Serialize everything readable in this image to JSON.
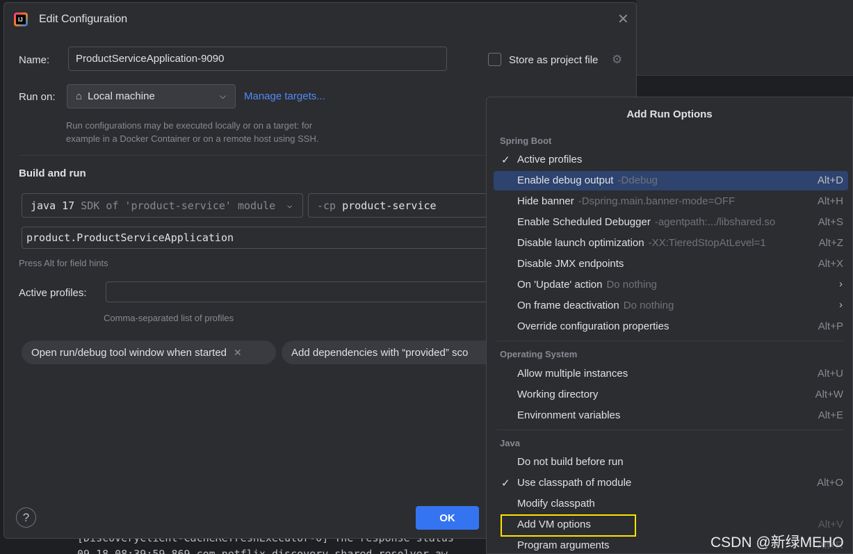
{
  "dialog": {
    "title": "Edit Configuration",
    "name_label": "Name:",
    "name_value": "ProductServiceApplication-9090",
    "store_label": "Store as project file",
    "run_on_label": "Run on:",
    "run_on_value": "Local machine",
    "manage_targets": "Manage targets...",
    "run_on_hint": [
      "Run configurations may be executed locally or on a target: for",
      "example in a Docker Container or on a remote host using SSH."
    ],
    "build_and_run": "Build and run",
    "sdk_value": "java 17",
    "sdk_suffix": "SDK of 'product-service' module",
    "cp_prefix": "-cp",
    "cp_value": "product-service",
    "main_class": "product.ProductServiceApplication",
    "field_hint": "Press Alt for field hints",
    "active_profiles_label": "Active profiles:",
    "active_profiles_hint": "Comma-separated list of profiles",
    "chips": [
      "Open run/debug tool window when started",
      "Add dependencies with “provided” sco"
    ],
    "help": "?",
    "ok": "OK"
  },
  "popup": {
    "title": "Add Run Options",
    "groups": {
      "spring_boot": "Spring Boot",
      "operating_system": "Operating System",
      "java": "Java"
    },
    "spring_boot_items": [
      {
        "label": "Active profiles",
        "sub": "",
        "shortcut": "",
        "checked": "✓"
      },
      {
        "label": "Enable debug output",
        "sub": "-Ddebug",
        "shortcut": "Alt+D",
        "checked": ""
      },
      {
        "label": "Hide banner",
        "sub": "-Dspring.main.banner-mode=OFF",
        "shortcut": "Alt+H",
        "checked": ""
      },
      {
        "label": "Enable Scheduled Debugger",
        "sub": "-agentpath:.../libshared.so",
        "shortcut": "Alt+S",
        "checked": ""
      },
      {
        "label": "Disable launch optimization",
        "sub": "-XX:TieredStopAtLevel=1",
        "shortcut": "Alt+Z",
        "checked": ""
      },
      {
        "label": "Disable JMX endpoints",
        "sub": "",
        "shortcut": "Alt+X",
        "checked": ""
      },
      {
        "label": "On 'Update' action",
        "sub": "Do nothing",
        "shortcut": "",
        "checked": ""
      },
      {
        "label": "On frame deactivation",
        "sub": "Do nothing",
        "shortcut": "",
        "checked": ""
      },
      {
        "label": "Override configuration properties",
        "sub": "",
        "shortcut": "Alt+P",
        "checked": ""
      }
    ],
    "os_items": [
      {
        "label": "Allow multiple instances",
        "shortcut": "Alt+U"
      },
      {
        "label": "Working directory",
        "shortcut": "Alt+W"
      },
      {
        "label": "Environment variables",
        "shortcut": "Alt+E"
      }
    ],
    "java_items": [
      {
        "label": "Do not build before run",
        "shortcut": "",
        "checked": ""
      },
      {
        "label": "Use classpath of module",
        "shortcut": "Alt+O",
        "checked": "✓"
      },
      {
        "label": "Modify classpath",
        "shortcut": "",
        "checked": ""
      },
      {
        "label": "Add VM options",
        "shortcut": "Alt+V",
        "checked": ""
      },
      {
        "label": "Program arguments",
        "shortcut": "Alt+R",
        "checked": ""
      }
    ]
  },
  "console": {
    "line1": "[DiscoveryClient-CacheRefreshExecutor-0] The response status",
    "line2": "09-18 08:39:59.869 com.netflix.discovery.shared.resolver.aw"
  },
  "watermark": "CSDN @新绿MEHO",
  "colors": {
    "accent": "#3574f0",
    "link": "#548af7",
    "selection": "#2e436e",
    "highlight": "#ffe400"
  }
}
